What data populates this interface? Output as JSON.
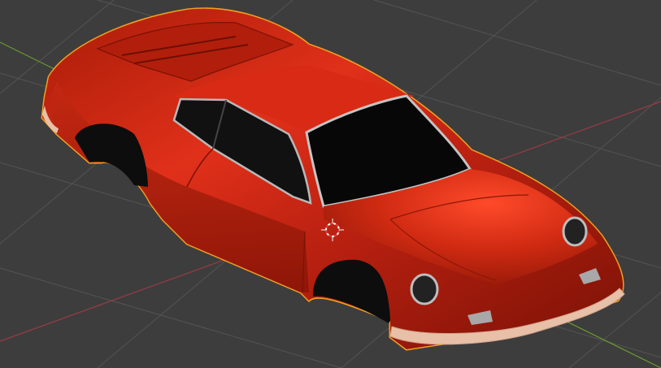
{
  "viewport": {
    "mode": "3d-viewport",
    "background": "#3d3d3d",
    "grid_color": "#545454",
    "x_axis_color": "#9b3b48",
    "y_axis_color": "#6d9a2c",
    "selection_outline_color": "#f0a020",
    "object": {
      "name": "car-body",
      "body_color": "#c8260f",
      "body_dark": "#7a1206",
      "glass_color": "#0a0a0a",
      "trim_color": "#c9c9c9",
      "bumper_color": "#e8c0a8",
      "selected": true
    },
    "cursor_3d": {
      "shown": true,
      "colors": [
        "#ffffff",
        "#e04040"
      ]
    }
  }
}
